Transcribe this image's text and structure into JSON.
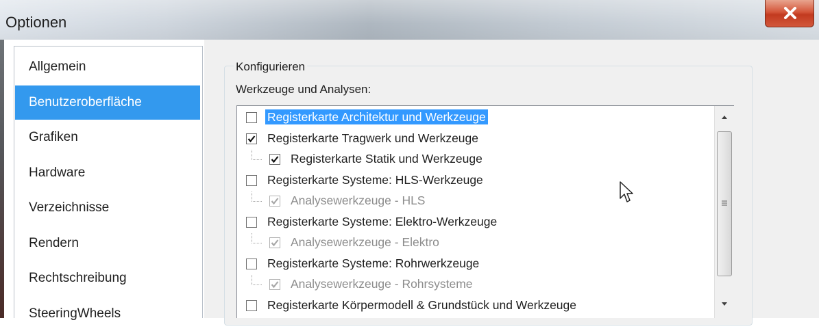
{
  "window": {
    "title": "Optionen"
  },
  "sidebar": {
    "items": [
      {
        "label": "Allgemein",
        "active": false
      },
      {
        "label": "Benutzeroberfläche",
        "active": true
      },
      {
        "label": "Grafiken",
        "active": false
      },
      {
        "label": "Hardware",
        "active": false
      },
      {
        "label": "Verzeichnisse",
        "active": false
      },
      {
        "label": "Rendern",
        "active": false
      },
      {
        "label": "Rechtschreibung",
        "active": false
      },
      {
        "label": "SteeringWheels",
        "active": false
      }
    ]
  },
  "main": {
    "group_title": "Konfigurieren",
    "section_label": "Werkzeuge und Analysen:",
    "tools": [
      {
        "label": "Registerkarte Architektur und Werkzeuge",
        "checked": false,
        "enabled": true,
        "selected": true,
        "level": 0
      },
      {
        "label": "Registerkarte Tragwerk und Werkzeuge",
        "checked": true,
        "enabled": true,
        "selected": false,
        "level": 0
      },
      {
        "label": "Registerkarte Statik und Werkzeuge",
        "checked": true,
        "enabled": true,
        "selected": false,
        "level": 1
      },
      {
        "label": "Registerkarte Systeme: HLS-Werkzeuge",
        "checked": false,
        "enabled": true,
        "selected": false,
        "level": 0
      },
      {
        "label": "Analysewerkzeuge - HLS",
        "checked": true,
        "enabled": false,
        "selected": false,
        "level": 1
      },
      {
        "label": "Registerkarte Systeme: Elektro-Werkzeuge",
        "checked": false,
        "enabled": true,
        "selected": false,
        "level": 0
      },
      {
        "label": "Analysewerkzeuge - Elektro",
        "checked": true,
        "enabled": false,
        "selected": false,
        "level": 1
      },
      {
        "label": "Registerkarte Systeme: Rohrwerkzeuge",
        "checked": false,
        "enabled": true,
        "selected": false,
        "level": 0
      },
      {
        "label": "Analysewerkzeuge - Rohrsysteme",
        "checked": true,
        "enabled": false,
        "selected": false,
        "level": 1
      },
      {
        "label": "Registerkarte Körpermodell & Grundstück und Werkzeuge",
        "checked": false,
        "enabled": true,
        "selected": false,
        "level": 0
      }
    ]
  },
  "icons": {
    "close": "close-icon",
    "checkmark": "checkmark-icon",
    "scroll_up": "scroll-up-arrow-icon",
    "scroll_down": "scroll-down-arrow-icon",
    "cursor": "mouse-pointer-icon"
  },
  "colors": {
    "selection": "#3399ff",
    "sidebar_active": "#3399ee",
    "close_button": "#c23a1f"
  }
}
